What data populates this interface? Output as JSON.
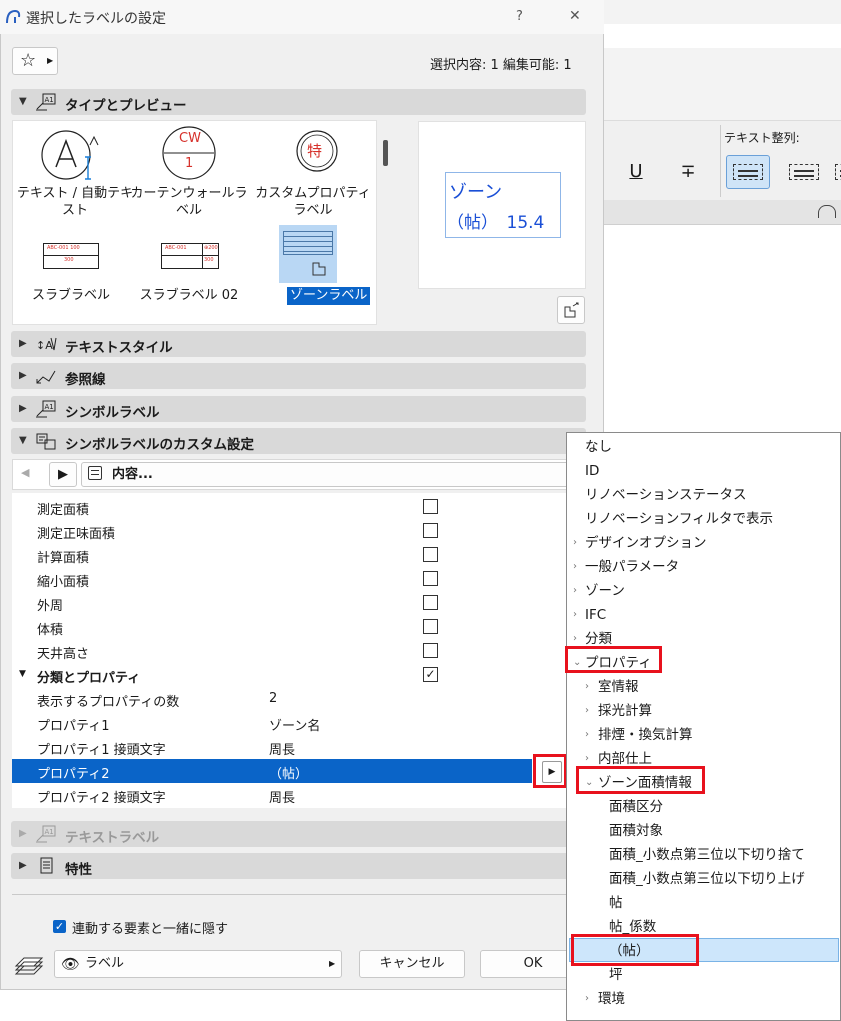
{
  "dialog": {
    "title": "選択したラベルの設定",
    "help": "?",
    "close": "✕",
    "selection_info": "選択内容: 1 編集可能: 1"
  },
  "sections": {
    "type_preview": "タイプとプレビュー",
    "text_style": "テキストスタイル",
    "reference_line": "参照線",
    "symbol_label": "シンボルラベル",
    "symbol_custom": "シンボルラベルのカスタム設定",
    "text_label": "テキストラベル",
    "properties": "特性"
  },
  "label_types": [
    {
      "label": "テキスト / 自動テキスト"
    },
    {
      "label": "カーテンウォールラベル"
    },
    {
      "label": "カスタムプロパティラベル"
    },
    {
      "label": "スラブラベル"
    },
    {
      "label": "スラブラベル 02"
    },
    {
      "label": "ゾーンラベル",
      "selected": true
    }
  ],
  "icons": {
    "cw_top": "CW",
    "cw_bottom": "1",
    "custom": "特",
    "slab_text": "ABC-001 100",
    "slab_sub": "300",
    "slab2_text": "ABC-001",
    "slab2_right": "⊕200",
    "slab2_sub": "300"
  },
  "preview": {
    "line1": "ゾーン",
    "line2": "（帖）　15.4"
  },
  "content_toolbar": {
    "label": "内容..."
  },
  "rows": [
    {
      "label": "測定面積",
      "checked": false
    },
    {
      "label": "測定正味面積",
      "checked": false
    },
    {
      "label": "計算面積",
      "checked": false
    },
    {
      "label": "縮小面積",
      "checked": false
    },
    {
      "label": "外周",
      "checked": false
    },
    {
      "label": "体積",
      "checked": false
    },
    {
      "label": "天井高さ",
      "checked": false
    }
  ],
  "group": {
    "label": "分類とプロパティ",
    "checked": true
  },
  "props": [
    {
      "label": "表示するプロパティの数",
      "value": "2"
    },
    {
      "label": "プロパティ1",
      "value": "ゾーン名"
    },
    {
      "label": "プロパティ1 接頭文字",
      "value": "周長"
    },
    {
      "label": "プロパティ2",
      "value": "（帖）",
      "selected": true
    },
    {
      "label": "プロパティ2 接頭文字",
      "value": "周長"
    }
  ],
  "footer": {
    "hide_checkbox": "連動する要素と一緒に隠す",
    "layer": "ラベル",
    "cancel": "キャンセル",
    "ok": "OK"
  },
  "background_app": {
    "text_align_label": "テキスト整列:",
    "underline": "U",
    "strike": "∓"
  },
  "menu": {
    "items": [
      {
        "label": "なし",
        "level": 0,
        "chevron": ""
      },
      {
        "label": "ID",
        "level": 0,
        "chevron": ""
      },
      {
        "label": "リノベーションステータス",
        "level": 0,
        "chevron": ""
      },
      {
        "label": "リノベーションフィルタで表示",
        "level": 0,
        "chevron": ""
      },
      {
        "label": "デザインオプション",
        "level": 0,
        "chevron": "›"
      },
      {
        "label": "一般パラメータ",
        "level": 0,
        "chevron": "›"
      },
      {
        "label": "ゾーン",
        "level": 0,
        "chevron": "›"
      },
      {
        "label": "IFC",
        "level": 0,
        "chevron": "›"
      },
      {
        "label": "分類",
        "level": 0,
        "chevron": "›"
      },
      {
        "label": "プロパティ",
        "level": 0,
        "chevron": "⌄"
      },
      {
        "label": "室情報",
        "level": 1,
        "chevron": "›"
      },
      {
        "label": "採光計算",
        "level": 1,
        "chevron": "›"
      },
      {
        "label": "排煙・換気計算",
        "level": 1,
        "chevron": "›"
      },
      {
        "label": "内部仕上",
        "level": 1,
        "chevron": "›"
      },
      {
        "label": "ゾーン面積情報",
        "level": 1,
        "chevron": "⌄"
      },
      {
        "label": "面積区分",
        "level": 2,
        "chevron": ""
      },
      {
        "label": "面積対象",
        "level": 2,
        "chevron": ""
      },
      {
        "label": "面積_小数点第三位以下切り捨て",
        "level": 2,
        "chevron": ""
      },
      {
        "label": "面積_小数点第三位以下切り上げ",
        "level": 2,
        "chevron": ""
      },
      {
        "label": "帖",
        "level": 2,
        "chevron": ""
      },
      {
        "label": "帖_係数",
        "level": 2,
        "chevron": ""
      },
      {
        "label": "（帖）",
        "level": 2,
        "chevron": "",
        "highlighted": true
      },
      {
        "label": "坪",
        "level": 2,
        "chevron": ""
      },
      {
        "label": "環境",
        "level": 1,
        "chevron": "›"
      }
    ]
  },
  "colors": {
    "accent": "#0a64c8",
    "annotation": "#e8111d",
    "preview_text": "#1a4fd6"
  }
}
